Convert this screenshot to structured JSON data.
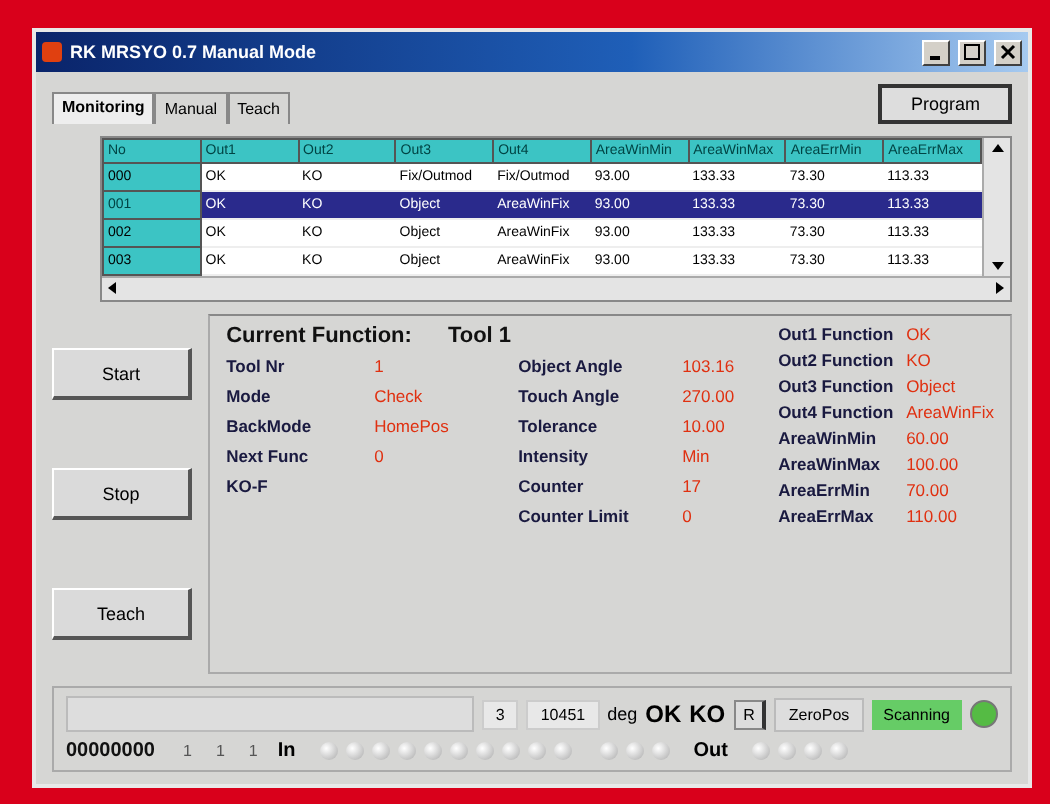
{
  "window": {
    "title": "RK MRSYO 0.7 Manual Mode"
  },
  "tabs": [
    {
      "label": "Monitoring",
      "selected": true
    },
    {
      "label": "Manual",
      "selected": false
    },
    {
      "label": "Teach",
      "selected": false
    }
  ],
  "program_button": "Program",
  "table": {
    "columns": [
      "No",
      "Out1",
      "Out2",
      "Out3",
      "Out4",
      "AreaWinMin",
      "AreaWinMax",
      "AreaErrMin",
      "AreaErrMax"
    ],
    "rows": [
      {
        "cells": [
          "000",
          "OK",
          "KO",
          "Fix/Outmod",
          "Fix/Outmod",
          "93.00",
          "133.33",
          "73.30",
          "113.33"
        ],
        "selected": false
      },
      {
        "cells": [
          "001",
          "OK",
          "KO",
          "Object",
          "AreaWinFix",
          "93.00",
          "133.33",
          "73.30",
          "113.33"
        ],
        "selected": true
      },
      {
        "cells": [
          "002",
          "OK",
          "KO",
          "Object",
          "AreaWinFix",
          "93.00",
          "133.33",
          "73.30",
          "113.33"
        ],
        "selected": false
      },
      {
        "cells": [
          "003",
          "OK",
          "KO",
          "Object",
          "AreaWinFix",
          "93.00",
          "133.33",
          "73.30",
          "113.33"
        ],
        "selected": false
      }
    ]
  },
  "side_buttons": [
    "Start",
    "Stop",
    "Teach"
  ],
  "current_function": {
    "label": "Current Function:",
    "value": "Tool 1"
  },
  "fields_left": [
    {
      "label": "Tool Nr",
      "value": "1"
    },
    {
      "label": "Mode",
      "value": "Check"
    },
    {
      "label": "BackMode",
      "value": "HomePos"
    },
    {
      "label": "Next Func",
      "value": "0"
    },
    {
      "label": "KO-F"
    }
  ],
  "fields_middle": [
    {
      "label": "Object Angle",
      "value": "103.16"
    },
    {
      "label": "Touch Angle",
      "value": "270.00"
    },
    {
      "label": "Tolerance",
      "value": "10.00"
    },
    {
      "label": "Intensity",
      "value": "Min"
    },
    {
      "label": "Counter",
      "value": "17"
    },
    {
      "label": "Counter Limit",
      "value": "0"
    }
  ],
  "fields_right": [
    {
      "label": "Out1 Function",
      "value": "OK"
    },
    {
      "label": "Out2 Function",
      "value": "KO"
    },
    {
      "label": "Out3 Function",
      "value": "Object"
    },
    {
      "label": "Out4 Function",
      "value": "AreaWinFix"
    },
    {
      "label": "AreaWinMin",
      "value": "60.00"
    },
    {
      "label": "AreaWinMax",
      "value": "100.00"
    },
    {
      "label": "AreaErrMin",
      "value": "70.00"
    },
    {
      "label": "AreaErrMax",
      "value": "110.00"
    }
  ],
  "status": {
    "count": "3",
    "angle": "10451",
    "unit": "deg",
    "ok": "OK",
    "ko": "KO",
    "r_button": "R",
    "zero_button": "ZeroPos",
    "scanning": "Scanning",
    "scanning_on": true,
    "led_on": true
  },
  "io": {
    "code": "00000000",
    "digits": [
      "1",
      "1",
      "1"
    ],
    "in_label": "In",
    "out_label": "Out",
    "inputs": [
      {
        "on": false
      },
      {
        "on": false
      },
      {
        "on": false
      },
      {
        "on": false
      },
      {
        "on": false
      },
      {
        "on": false
      },
      {
        "on": false
      },
      {
        "on": false
      },
      {
        "on": false
      },
      {
        "on": false
      },
      {
        "on": false
      },
      {
        "on": false
      },
      {
        "on": false
      }
    ],
    "outputs": [
      {
        "on": false
      },
      {
        "on": false
      },
      {
        "on": false
      },
      {
        "on": false
      }
    ]
  }
}
